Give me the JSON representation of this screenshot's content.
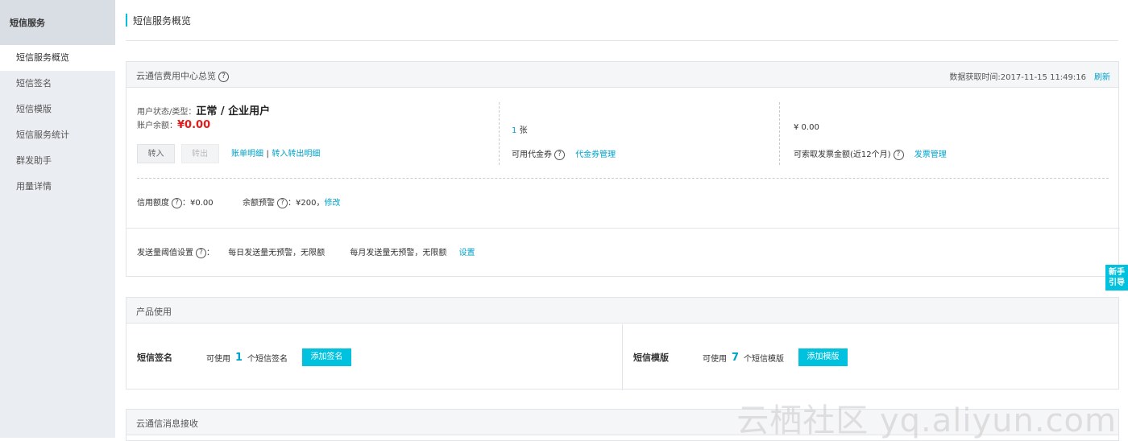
{
  "sidebar": {
    "title": "短信服务",
    "items": [
      {
        "label": "短信服务概览"
      },
      {
        "label": "短信签名"
      },
      {
        "label": "短信模版"
      },
      {
        "label": "短信服务统计"
      },
      {
        "label": "群发助手"
      },
      {
        "label": "用量详情"
      }
    ]
  },
  "page_title": "短信服务概览",
  "overview": {
    "header": "云通信费用中心总览",
    "fetch_time_label": "数据获取时间:2017-11-15 11:49:16",
    "refresh": "刷新",
    "user_status_label": "用户状态/类型：",
    "user_status_value": "正常 / 企业用户",
    "balance_label": "账户余额：",
    "balance_value": "¥0.00",
    "transfer_in": "转入",
    "transfer_out": "转出",
    "bill_detail": "账单明细",
    "sep": "|",
    "transfer_detail": "转入转出明细",
    "voucher_count": "1",
    "voucher_unit": "张",
    "voucher_label": "可用代金券",
    "voucher_manage": "代金券管理",
    "invoice_value": "¥ 0.00",
    "invoice_label": "可索取发票金额(近12个月)",
    "invoice_manage": "发票管理",
    "credit_label": "信用额度",
    "credit_value": "：¥0.00",
    "balance_warn_label": "余额预警",
    "balance_warn_value": "：¥200，",
    "modify": "修改",
    "threshold_label": "发送量阈值设置",
    "threshold_colon": "：",
    "daily_text": "每日发送量无预警，无限额",
    "monthly_text": "每月发送量无预警，无限额",
    "settings": "设置"
  },
  "product": {
    "header": "产品使用",
    "sign": {
      "title": "短信签名",
      "pre": "可使用",
      "count": "1",
      "post": "个短信签名",
      "button": "添加签名"
    },
    "template": {
      "title": "短信模版",
      "pre": "可使用",
      "count": "7",
      "post": "个短信模版",
      "button": "添加模版"
    }
  },
  "message_receive": {
    "header": "云通信消息接收"
  },
  "guide": {
    "line1": "新手",
    "line2": "引导"
  },
  "watermark": "云栖社区 yq.aliyun.com",
  "help_glyph": "?"
}
